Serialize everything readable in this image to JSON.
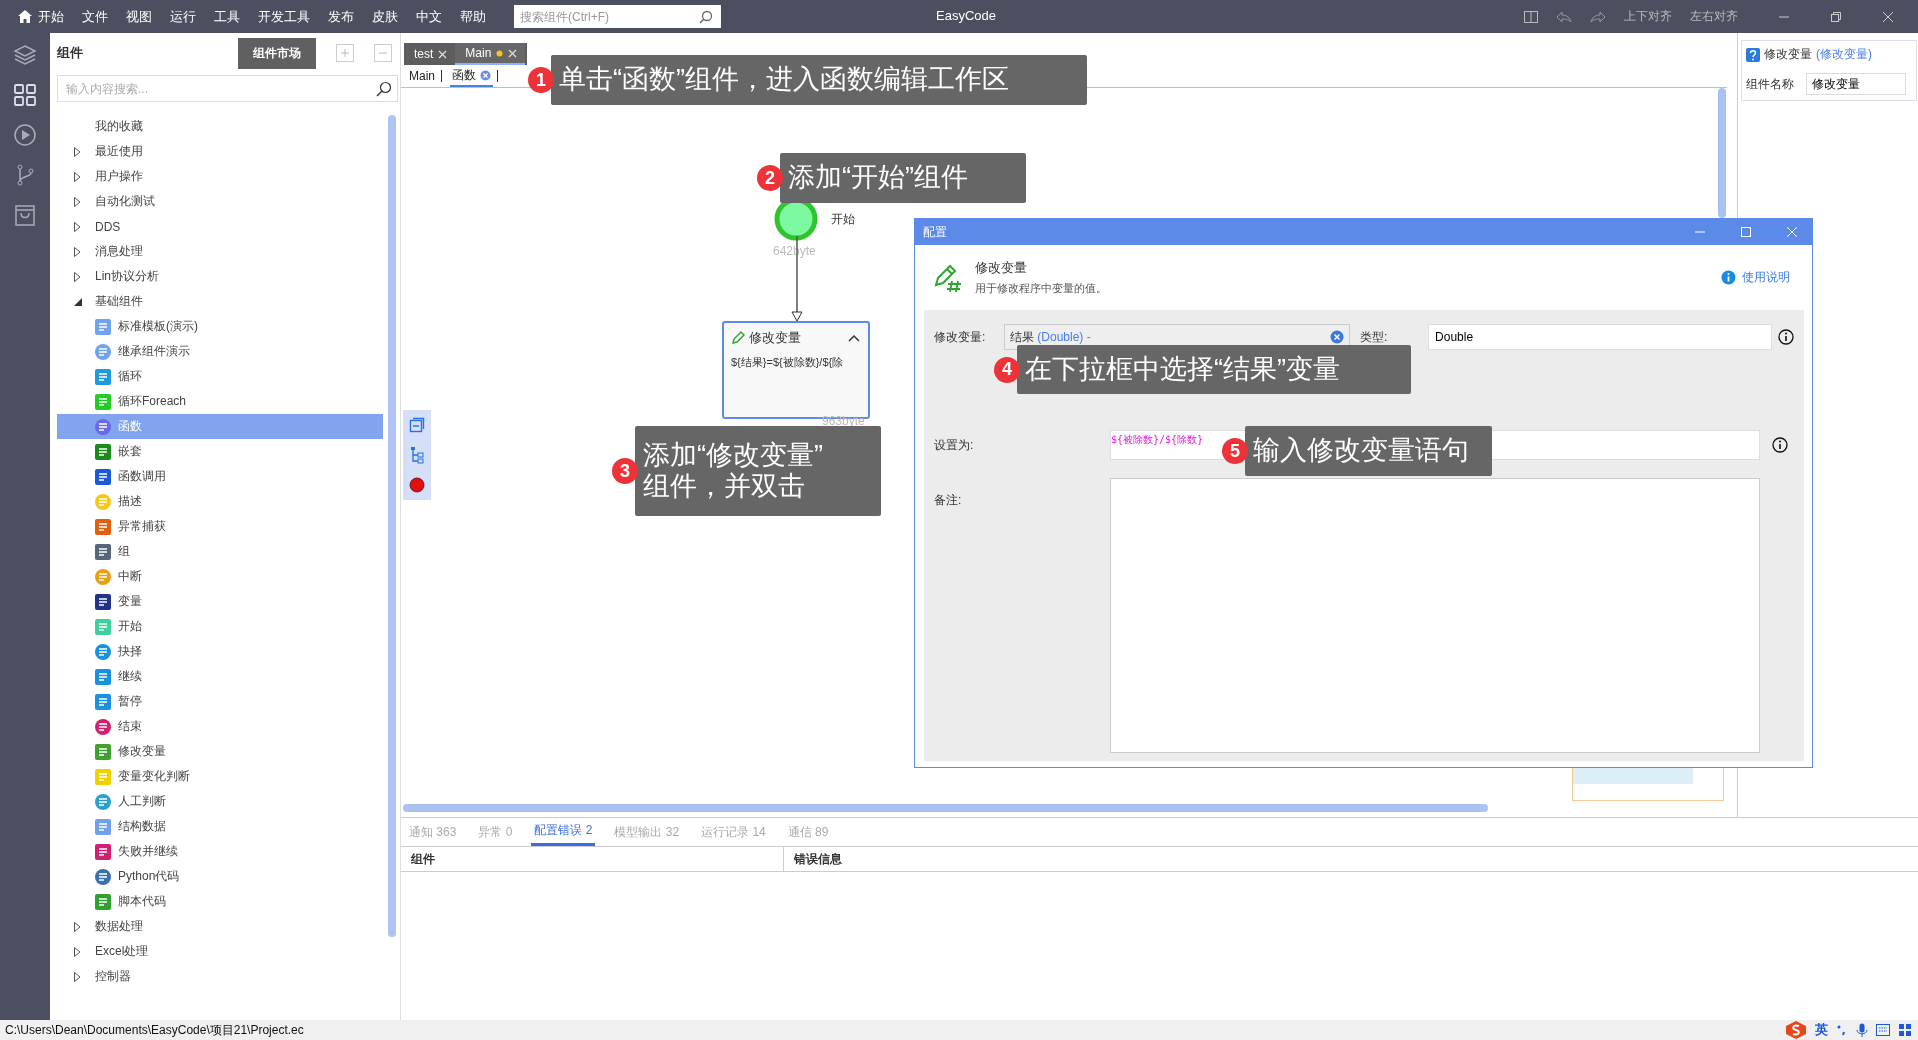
{
  "menu_bar": {
    "items": [
      {
        "label": "开始",
        "kind": "home"
      },
      {
        "label": "文件",
        "kind": "menu"
      },
      {
        "label": "视图",
        "kind": "menu"
      },
      {
        "label": "运行",
        "kind": "menu"
      },
      {
        "label": "工具",
        "kind": "menu"
      },
      {
        "label": "开发工具",
        "kind": "menu"
      },
      {
        "label": "发布",
        "kind": "menu"
      },
      {
        "label": "皮肤",
        "kind": "menu"
      },
      {
        "label": "中文",
        "kind": "menu"
      },
      {
        "label": "帮助",
        "kind": "menu"
      }
    ],
    "search": {
      "placeholder": "搜索组件(Ctrl+F)"
    },
    "title": "EasyCode",
    "align_buttons": [
      "上下对齐",
      "左右对齐"
    ]
  },
  "sidebar": {
    "title": "组件",
    "market_button": "组件市场",
    "search": {
      "placeholder": "输入内容搜索..."
    },
    "tree": [
      {
        "label": "我的收藏",
        "kind": "plain"
      },
      {
        "label": "最近使用",
        "kind": "group",
        "expanded": false
      },
      {
        "label": "用户操作",
        "kind": "group",
        "expanded": false
      },
      {
        "label": "自动化测试",
        "kind": "group",
        "expanded": false
      },
      {
        "label": "DDS",
        "kind": "group",
        "expanded": false
      },
      {
        "label": "消息处理",
        "kind": "group",
        "expanded": false
      },
      {
        "label": "Lin协议分析",
        "kind": "group",
        "expanded": false
      },
      {
        "label": "基础组件",
        "kind": "group",
        "expanded": true,
        "children": [
          {
            "label": "标准模板(演示)",
            "selected": false
          },
          {
            "label": "继承组件演示",
            "selected": false
          },
          {
            "label": "循环",
            "selected": false
          },
          {
            "label": "循环Foreach",
            "selected": false
          },
          {
            "label": "函数",
            "selected": true
          },
          {
            "label": "嵌套",
            "selected": false
          },
          {
            "label": "函数调用",
            "selected": false
          },
          {
            "label": "描述",
            "selected": false
          },
          {
            "label": "异常捕获",
            "selected": false
          },
          {
            "label": "组",
            "selected": false
          },
          {
            "label": "中断",
            "selected": false
          },
          {
            "label": "变量",
            "selected": false
          },
          {
            "label": "开始",
            "selected": false
          },
          {
            "label": "抉择",
            "selected": false
          },
          {
            "label": "继续",
            "selected": false
          },
          {
            "label": "暂停",
            "selected": false
          },
          {
            "label": "结束",
            "selected": false
          },
          {
            "label": "修改变量",
            "selected": false
          },
          {
            "label": "变量变化判断",
            "selected": false
          },
          {
            "label": "人工判断",
            "selected": false
          },
          {
            "label": "结构数据",
            "selected": false
          },
          {
            "label": "失败并继续",
            "selected": false
          },
          {
            "label": "Python代码",
            "selected": false
          },
          {
            "label": "脚本代码",
            "selected": false
          }
        ]
      },
      {
        "label": "数据处理",
        "kind": "group",
        "expanded": false
      },
      {
        "label": "Excel处理",
        "kind": "group",
        "expanded": false
      },
      {
        "label": "控制器",
        "kind": "group",
        "expanded": false
      }
    ]
  },
  "editor_tabs": [
    {
      "label": "test",
      "selected": false,
      "modified": false
    },
    {
      "label": "Main",
      "selected": true,
      "modified": true
    }
  ],
  "breadcrumb": [
    {
      "label": "Main",
      "selected": false,
      "closable": false
    },
    {
      "label": "函数",
      "selected": true,
      "closable": true
    }
  ],
  "canvas": {
    "start_node": {
      "label": "开始",
      "size": "642byte"
    },
    "variable_node": {
      "title": "修改变量",
      "expression": "${结果}=${被除数}/${除",
      "size": "963byte",
      "expanded": true
    }
  },
  "callouts": [
    {
      "number": "1",
      "text": "单击“函数”组件，进入函数编辑工作区"
    },
    {
      "number": "2",
      "text": "添加“开始”组件"
    },
    {
      "number": "3",
      "text": "添加“修改变量”\n组件，并双击"
    },
    {
      "number": "4",
      "text": "在下拉框中选择“结果”变量"
    },
    {
      "number": "5",
      "text": "输入修改变量语句"
    }
  ],
  "dialog": {
    "title": "配置",
    "component_name": "修改变量",
    "description": "用于修改程序中变量的值。",
    "help_link": "使用说明",
    "variable_field": {
      "label": "修改变量:",
      "value": "结果",
      "type_hint": "(Double) -"
    },
    "type_field": {
      "label": "类型:",
      "value": "Double"
    },
    "set_field": {
      "label": "设置为:",
      "value": "${被除数}/${除数}"
    },
    "note_field": {
      "label": "备注:"
    }
  },
  "properties": {
    "title": "修改变量",
    "subtitle": "(修改变量)",
    "name_label": "组件名称",
    "name_value": "修改变量"
  },
  "output_tabs": [
    {
      "label": "通知",
      "count": "363",
      "selected": false
    },
    {
      "label": "异常",
      "count": "0",
      "selected": false
    },
    {
      "label": "配置错误",
      "count": "2",
      "selected": true
    },
    {
      "label": "模型输出",
      "count": "32",
      "selected": false
    },
    {
      "label": "运行记录",
      "count": "14",
      "selected": false
    },
    {
      "label": "通信",
      "count": "89",
      "selected": false
    }
  ],
  "error_table": {
    "columns": [
      "组件",
      "错误信息"
    ]
  },
  "status_bar": {
    "path": "C:\\Users\\Dean\\Documents\\EasyCode\\项目21\\Project.ec",
    "ime_mode": "英"
  }
}
